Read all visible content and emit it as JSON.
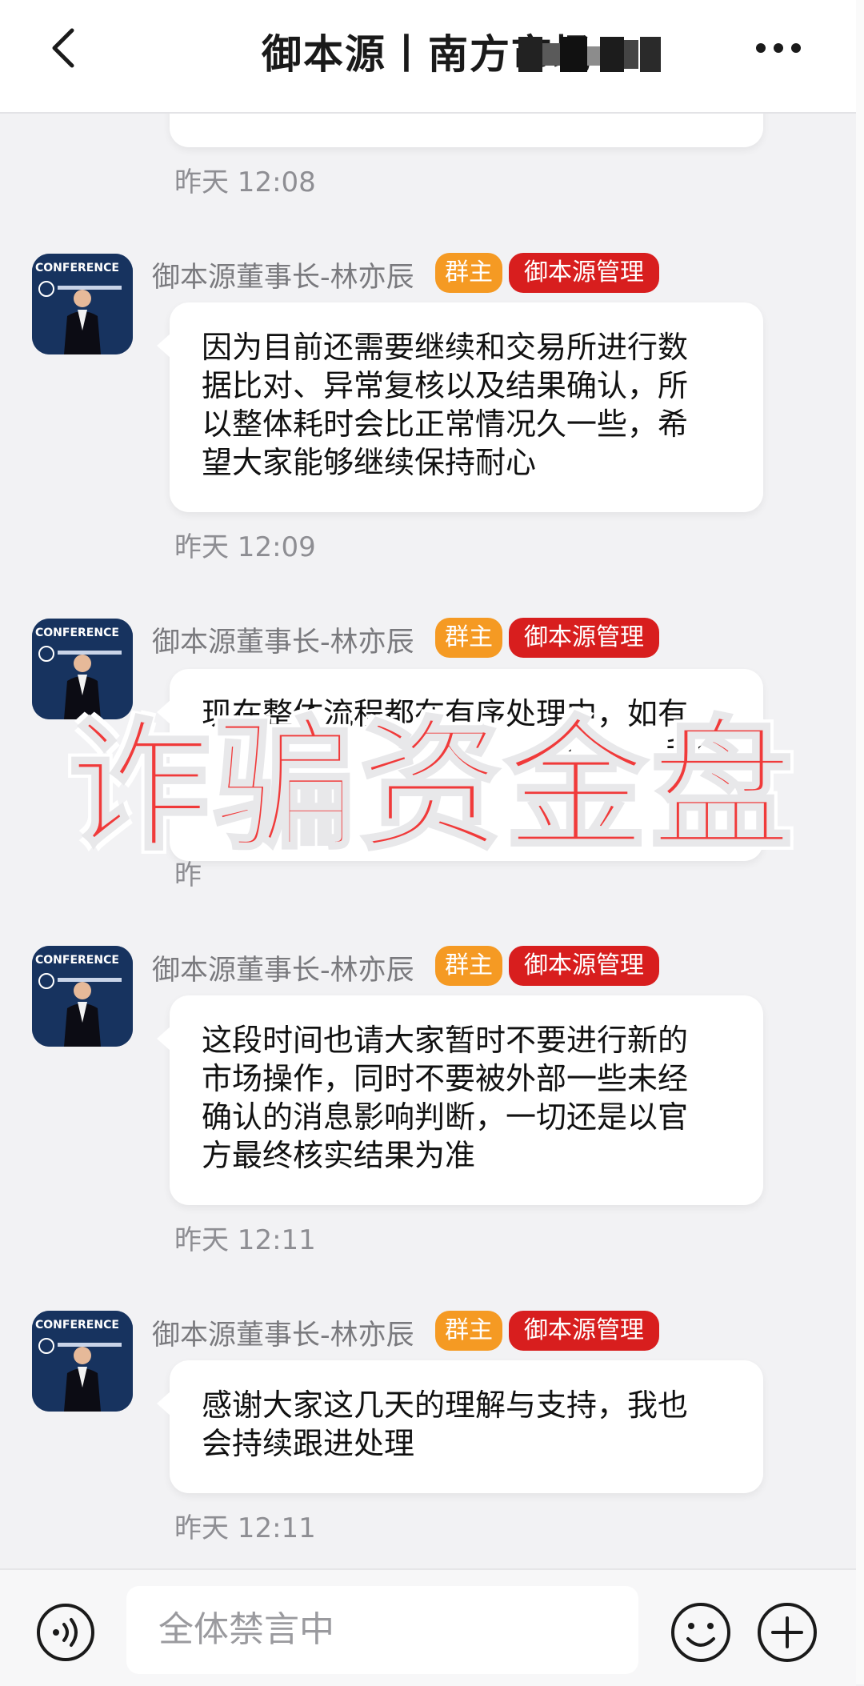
{
  "header": {
    "title": "御本源丨南方市场",
    "back_icon": "chevron-left-icon",
    "more_icon": "more-icon"
  },
  "first_message": {
    "time": "昨天 12:08"
  },
  "messages": [
    {
      "sender": "御本源董事长-林亦辰",
      "badges": [
        "群主",
        "御本源管理"
      ],
      "lines": [
        "因为目前还需要继续和交易所进行数",
        "据比对、异常复核以及结果确认，所",
        "以整体耗时会比正常情况久一些，希",
        "望大家能够继续保持耐心"
      ],
      "time": "昨天 12:09"
    },
    {
      "sender": "御本源董事长-林亦辰",
      "badges": [
        "群主",
        "御本源管理"
      ],
      "lines": [
        "现在整体流程都在有序处理中，如有",
        "实续",
        "我会"
      ],
      "time": "昨"
    },
    {
      "sender": "御本源董事长-林亦辰",
      "badges": [
        "群主",
        "御本源管理"
      ],
      "lines": [
        "这段时间也请大家暂时不要进行新的",
        "市场操作，同时不要被外部一些未经",
        "确认的消息影响判断，一切还是以官",
        "方最终核实结果为准"
      ],
      "time": "昨天 12:11"
    },
    {
      "sender": "御本源董事长-林亦辰",
      "badges": [
        "群主",
        "御本源管理"
      ],
      "lines": [
        "感谢大家这几天的理解与支持，我也",
        "会持续跟进处理"
      ],
      "time": "昨天 12:11"
    }
  ],
  "watermark": "诈骗资金盘",
  "avatar_text": "CONFERENCE",
  "bottom_bar": {
    "input_placeholder": "全体禁言中",
    "voice_icon": "voice-icon",
    "emoji_icon": "emoji-icon",
    "plus_icon": "plus-icon"
  },
  "colors": {
    "owner_badge": "#f59a23",
    "admin_badge": "#d81e1e",
    "watermark": "#f03a3a"
  }
}
